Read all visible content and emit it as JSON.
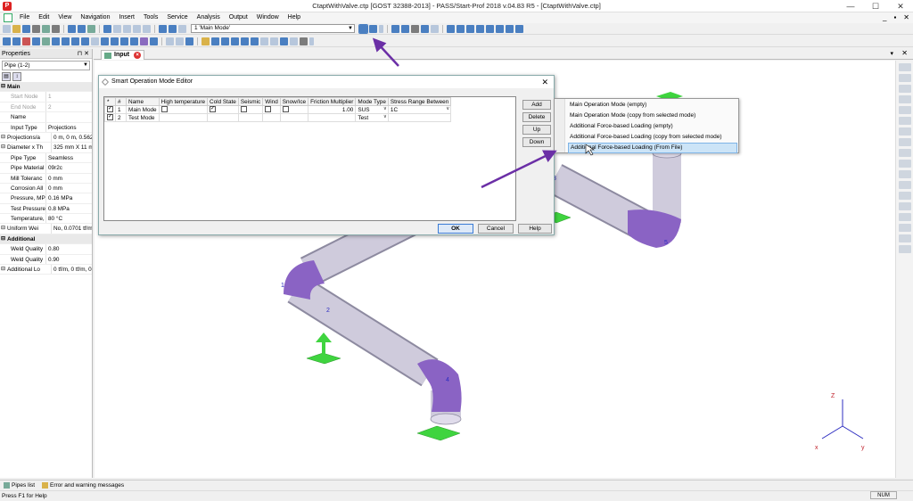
{
  "window": {
    "title": "CtaptWithValve.ctp [GOST 32388-2013] - PASS/Start-Prof 2018 v.04.83 R5 - [CtaptWithValve.ctp]",
    "minimize": "—",
    "maximize": "☐",
    "close": "✕"
  },
  "menubar": {
    "items": [
      "File",
      "Edit",
      "View",
      "Navigation",
      "Insert",
      "Tools",
      "Service",
      "Analysis",
      "Output",
      "Window",
      "Help"
    ],
    "mdi_min": "_",
    "mdi_max": "▪",
    "mdi_close": "✕"
  },
  "toolbar": {
    "mode_select_value": "1 'Main Mode'"
  },
  "properties": {
    "title": "Properties",
    "object_select": "Pipe (1-2)",
    "rows": [
      {
        "type": "cat",
        "key": "Main"
      },
      {
        "type": "gray",
        "key": "Start Node",
        "value": "1"
      },
      {
        "type": "gray",
        "key": "End Node",
        "value": "2"
      },
      {
        "type": "row",
        "key": "Name",
        "value": ""
      },
      {
        "type": "row",
        "key": "Input Type",
        "value": "Projections"
      },
      {
        "type": "exp",
        "key": "Projections/a",
        "value": "0 m, 0 m, 0.562 m"
      },
      {
        "type": "exp",
        "key": "Diameter x Th",
        "value": "325 mm X 11 mm"
      },
      {
        "type": "row",
        "key": "Pipe Type",
        "value": "Seamless"
      },
      {
        "type": "row",
        "key": "Pipe Material",
        "value": "09r2c"
      },
      {
        "type": "row",
        "key": "Mill Toleranc",
        "value": "0 mm"
      },
      {
        "type": "row",
        "key": "Corrosion All",
        "value": "0 mm"
      },
      {
        "type": "row",
        "key": "Pressure, MPa",
        "value": "0.16 MPa"
      },
      {
        "type": "row",
        "key": "Test Pressure,",
        "value": "0.8 MPa"
      },
      {
        "type": "row",
        "key": "Temperature,",
        "value": "80 °C"
      },
      {
        "type": "exp",
        "key": "Uniform Wei",
        "value": "No, 0.0701 tf/m,"
      },
      {
        "type": "cat",
        "key": "Additional"
      },
      {
        "type": "row",
        "key": "Weld Quality",
        "value": "0.80"
      },
      {
        "type": "row",
        "key": "Weld Quality",
        "value": "0.90"
      },
      {
        "type": "exp",
        "key": "Additional Lo",
        "value": "0 tf/m, 0 tf/m, 0"
      }
    ]
  },
  "tabs": {
    "input": "Input"
  },
  "dialog": {
    "title": "Smart Operation Mode Editor",
    "columns": [
      "*",
      "#",
      "Name",
      "High temperature",
      "Cold State",
      "Seismic",
      "Wind",
      "Snow/Ice",
      "Friction Multiplier",
      "Mode Type",
      "Stress Range Between"
    ],
    "rows": [
      {
        "num": "1",
        "name": "Main Mode",
        "friction": "1.00",
        "mode_type": "SUS",
        "stress_range": "1C"
      },
      {
        "num": "2",
        "name": "Test Mode",
        "friction": "",
        "mode_type": "Test",
        "stress_range": ""
      }
    ],
    "side_buttons": {
      "add": "Add",
      "delete": "Delete",
      "up": "Up",
      "down": "Down"
    },
    "footer_buttons": {
      "ok": "OK",
      "cancel": "Cancel",
      "help": "Help"
    }
  },
  "add_menu": {
    "items": [
      "Main Operation Mode (empty)",
      "Main Operation Mode (copy from selected mode)",
      "Additional Force-based Loading (empty)",
      "Additional Force-based Loading (copy from selected mode)",
      "Additional Force-based Loading (From File)"
    ],
    "highlighted_index": 4
  },
  "viewport": {
    "node_labels": [
      "1",
      "2",
      "4",
      "3",
      "5"
    ],
    "axes": {
      "z": "Z",
      "x": "x",
      "y": "y"
    },
    "colors": {
      "pipe": "#c7c3d6",
      "elbow": "#8a63c4",
      "support": "#3fd43f",
      "axis": "#2c2cc0",
      "arrow": "#6b2fa6"
    }
  },
  "statusbar": {
    "tabs": [
      "Pipes list",
      "Error and warning messages"
    ],
    "help_text": "Press F1 for Help",
    "num": "NUM"
  }
}
